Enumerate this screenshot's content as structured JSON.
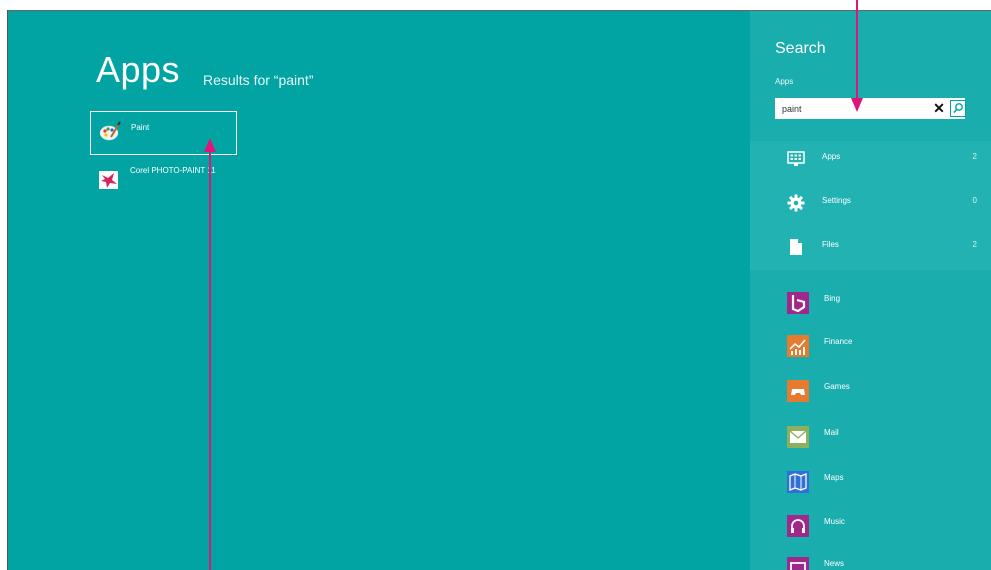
{
  "main": {
    "title": "Apps",
    "results_text": "Results for “paint”",
    "results": [
      {
        "label": "Paint",
        "icon": "palette-icon"
      },
      {
        "label": "Corel PHOTO-PAINT 11",
        "icon": "corel-photo-paint-icon"
      }
    ]
  },
  "search_pane": {
    "title": "Search",
    "scope": "Apps",
    "query": "paint",
    "clear_symbol": "✕",
    "categories": [
      {
        "label": "Apps",
        "count": "2",
        "icon": "apps-icon"
      },
      {
        "label": "Settings",
        "count": "0",
        "icon": "settings-gear-icon"
      },
      {
        "label": "Files",
        "count": "2",
        "icon": "file-icon"
      }
    ],
    "apps": [
      {
        "label": "Bing",
        "color": "#a0278b",
        "icon": "bing-icon"
      },
      {
        "label": "Finance",
        "color": "#e57b2e",
        "icon": "finance-icon"
      },
      {
        "label": "Games",
        "color": "#e57b2e",
        "icon": "games-icon"
      },
      {
        "label": "Mail",
        "color": "#8cb05d",
        "icon": "mail-icon"
      },
      {
        "label": "Maps",
        "color": "#2f6fd8",
        "icon": "maps-icon"
      },
      {
        "label": "Music",
        "color": "#a0278b",
        "icon": "headphones-icon"
      },
      {
        "label": "News",
        "color": "#a0278b",
        "icon": "news-icon"
      }
    ]
  },
  "colors": {
    "background": "#02a3a3",
    "pane": "#1aadad",
    "annotation_arrow": "#e0157a"
  }
}
